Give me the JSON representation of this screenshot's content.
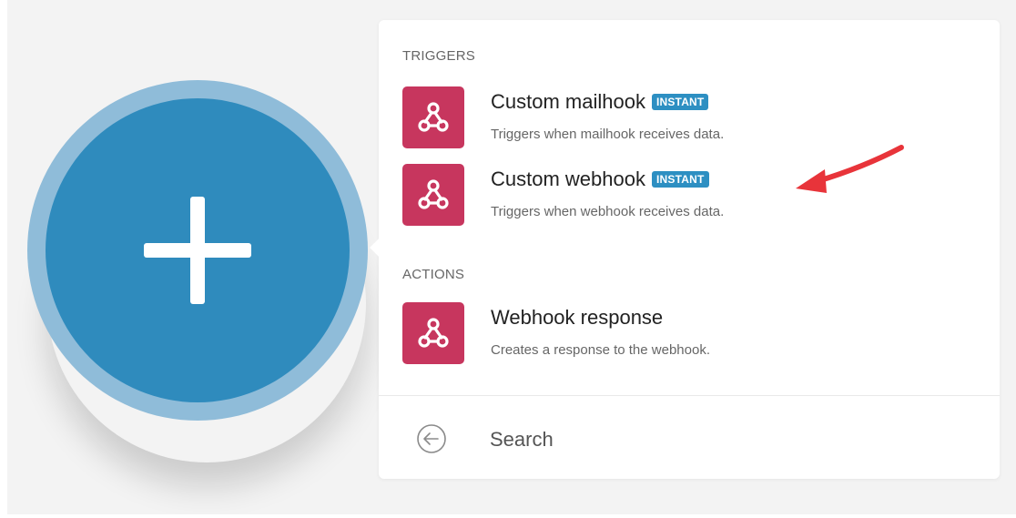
{
  "module": {
    "icon": "plus-icon",
    "colors": {
      "ring": "#8fbcd9",
      "core": "#2f8bbd"
    }
  },
  "panel": {
    "sections": [
      {
        "heading": "TRIGGERS",
        "items": [
          {
            "title": "Custom mailhook",
            "badge": "INSTANT",
            "description": "Triggers when mailhook receives data.",
            "icon": "webhook-icon"
          },
          {
            "title": "Custom webhook",
            "badge": "INSTANT",
            "description": "Triggers when webhook receives data.",
            "icon": "webhook-icon"
          }
        ]
      },
      {
        "heading": "ACTIONS",
        "items": [
          {
            "title": "Webhook response",
            "description": "Creates a response to the webhook.",
            "icon": "webhook-icon"
          }
        ]
      }
    ],
    "footer": {
      "back_icon": "arrow-left-circle-icon",
      "search_label": "Search"
    }
  },
  "colors": {
    "app_icon_bg": "#c7365e",
    "badge_bg": "#2d8fc2",
    "annotation_arrow": "#e8343a"
  }
}
